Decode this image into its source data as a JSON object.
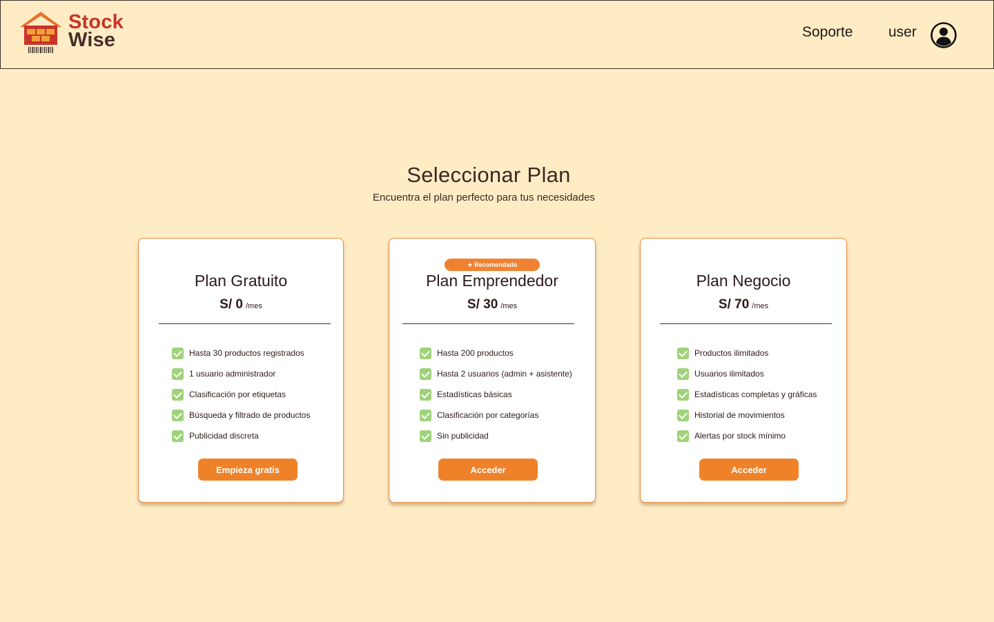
{
  "header": {
    "logo": {
      "line1": "Stock",
      "line2": "Wise"
    },
    "nav": {
      "support": "Soporte",
      "user": "user"
    }
  },
  "main": {
    "title": "Seleccionar  Plan",
    "subtitle": "Encuentra el plan perfecto para tus necesidades"
  },
  "plans": [
    {
      "name": "Plan Gratuito",
      "price": "S/ 0",
      "period": "/mes",
      "features": [
        "Hasta 30 productos registrados",
        "1 usuario administrador",
        "Clasificación por etiquetas",
        "Búsqueda y filtrado de productos",
        "Publicidad discreta"
      ],
      "cta": "Empieza gratis"
    },
    {
      "badge": "★  Recomendado",
      "name": "Plan Emprendedor",
      "price": "S/ 30",
      "period": "/mes",
      "features": [
        "Hasta 200 productos",
        "Hasta 2 usuarios (admin + asistente)",
        "Estadísticas básicas",
        "Clasificación por categorías",
        "Sin publicidad"
      ],
      "cta": "Acceder"
    },
    {
      "name": "Plan Negocio",
      "price": "S/ 70",
      "period": "/mes",
      "features": [
        "Productos ilimitados",
        "Usuarios ilimitados",
        "Estadísticas completas y gráficas",
        "Historial de movimientos",
        "Alertas por stock mínimo"
      ],
      "cta": "Acceder"
    }
  ],
  "colors": {
    "background": "#ffecc4",
    "accent": "#ef8229",
    "check": "#9fd37a",
    "brand_red": "#c9332a",
    "brand_brown": "#4a2c2a"
  },
  "icons": {
    "logo": "warehouse-icon",
    "user": "user-circle-icon",
    "check": "check-icon"
  }
}
